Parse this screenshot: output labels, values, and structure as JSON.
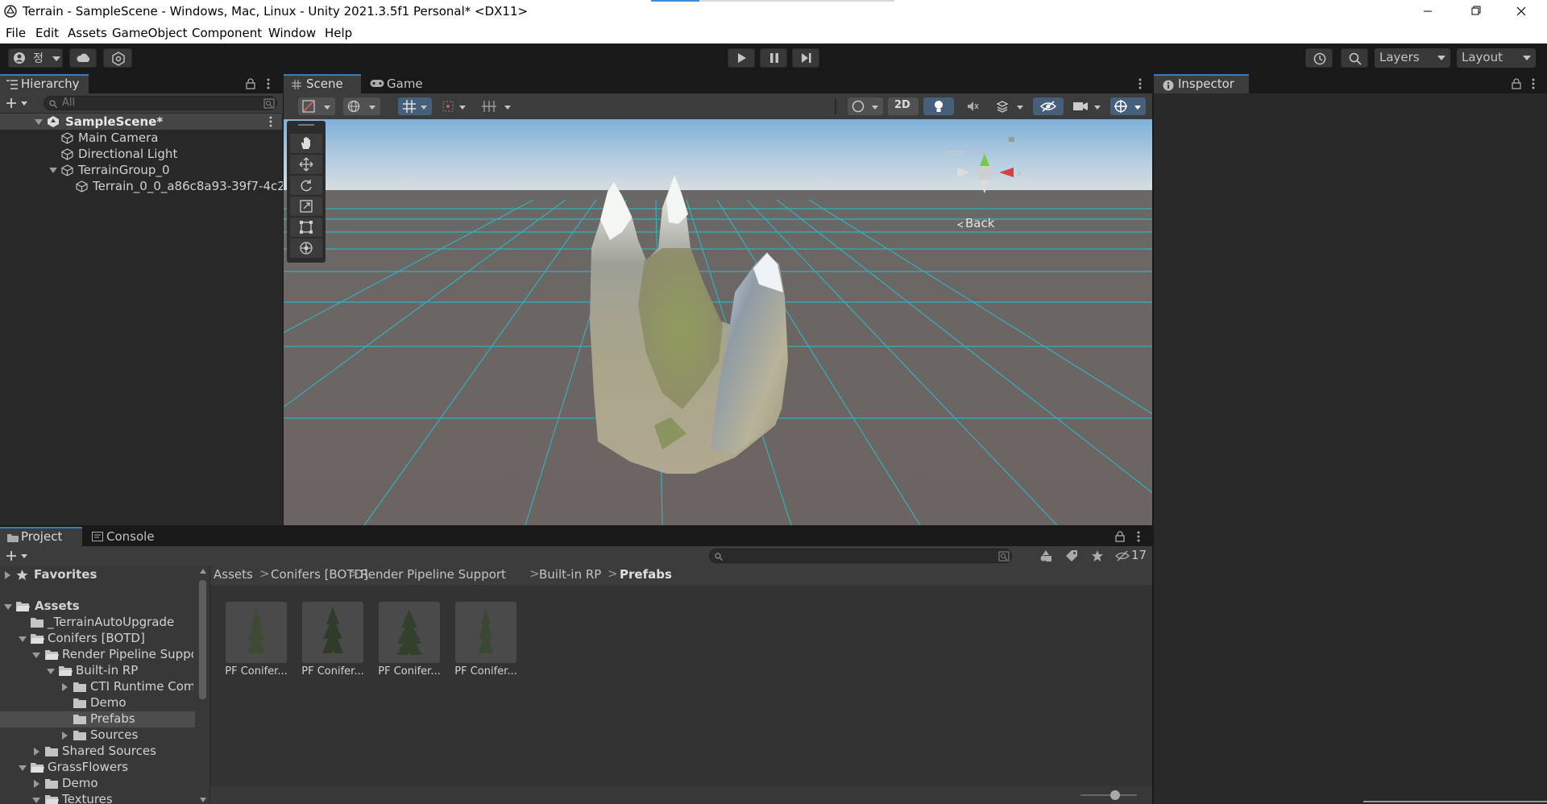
{
  "window": {
    "title": "Terrain - SampleScene - Windows, Mac, Linux - Unity 2021.3.5f1 Personal* <DX11>"
  },
  "menu": [
    "File",
    "Edit",
    "Assets",
    "GameObject",
    "Component",
    "Window",
    "Help"
  ],
  "toolbar": {
    "account_label": "정",
    "layers": "Layers",
    "layout": "Layout"
  },
  "hierarchy": {
    "tab": "Hierarchy",
    "search_placeholder": "All",
    "scene": "SampleScene*",
    "items": [
      "Main Camera",
      "Directional Light",
      "TerrainGroup_0",
      "Terrain_0_0_a86c8a93-39f7-4c2"
    ]
  },
  "scene_view": {
    "tabs": [
      "Scene",
      "Game"
    ],
    "mode_2d": "2D",
    "gizmo_label": "Back",
    "gizmo_axes": {
      "y": "y",
      "x": "x"
    }
  },
  "inspector": {
    "tab": "Inspector"
  },
  "project": {
    "tabs": [
      "Project",
      "Console"
    ],
    "favorites": "Favorites",
    "tree": [
      "Assets",
      "_TerrainAutoUpgrade",
      "Conifers [BOTD]",
      "Render Pipeline Suppo",
      "Built-in RP",
      "CTI Runtime Comp",
      "Demo",
      "Prefabs",
      "Sources",
      "Shared Sources",
      "GrassFlowers",
      "Demo",
      "Textures"
    ],
    "breadcrumb": [
      "Assets",
      "Conifers [BOTD]",
      "Render Pipeline Support",
      "Built-in RP",
      "Prefabs"
    ],
    "hidden_count": "17",
    "assets": [
      "PF Conifer...",
      "PF Conifer...",
      "PF Conifer...",
      "PF Conifer..."
    ]
  },
  "colors": {
    "accent": "#3a79bb",
    "selection": "#46607c",
    "panel": "#282828",
    "grid": "#2fb8c6"
  }
}
